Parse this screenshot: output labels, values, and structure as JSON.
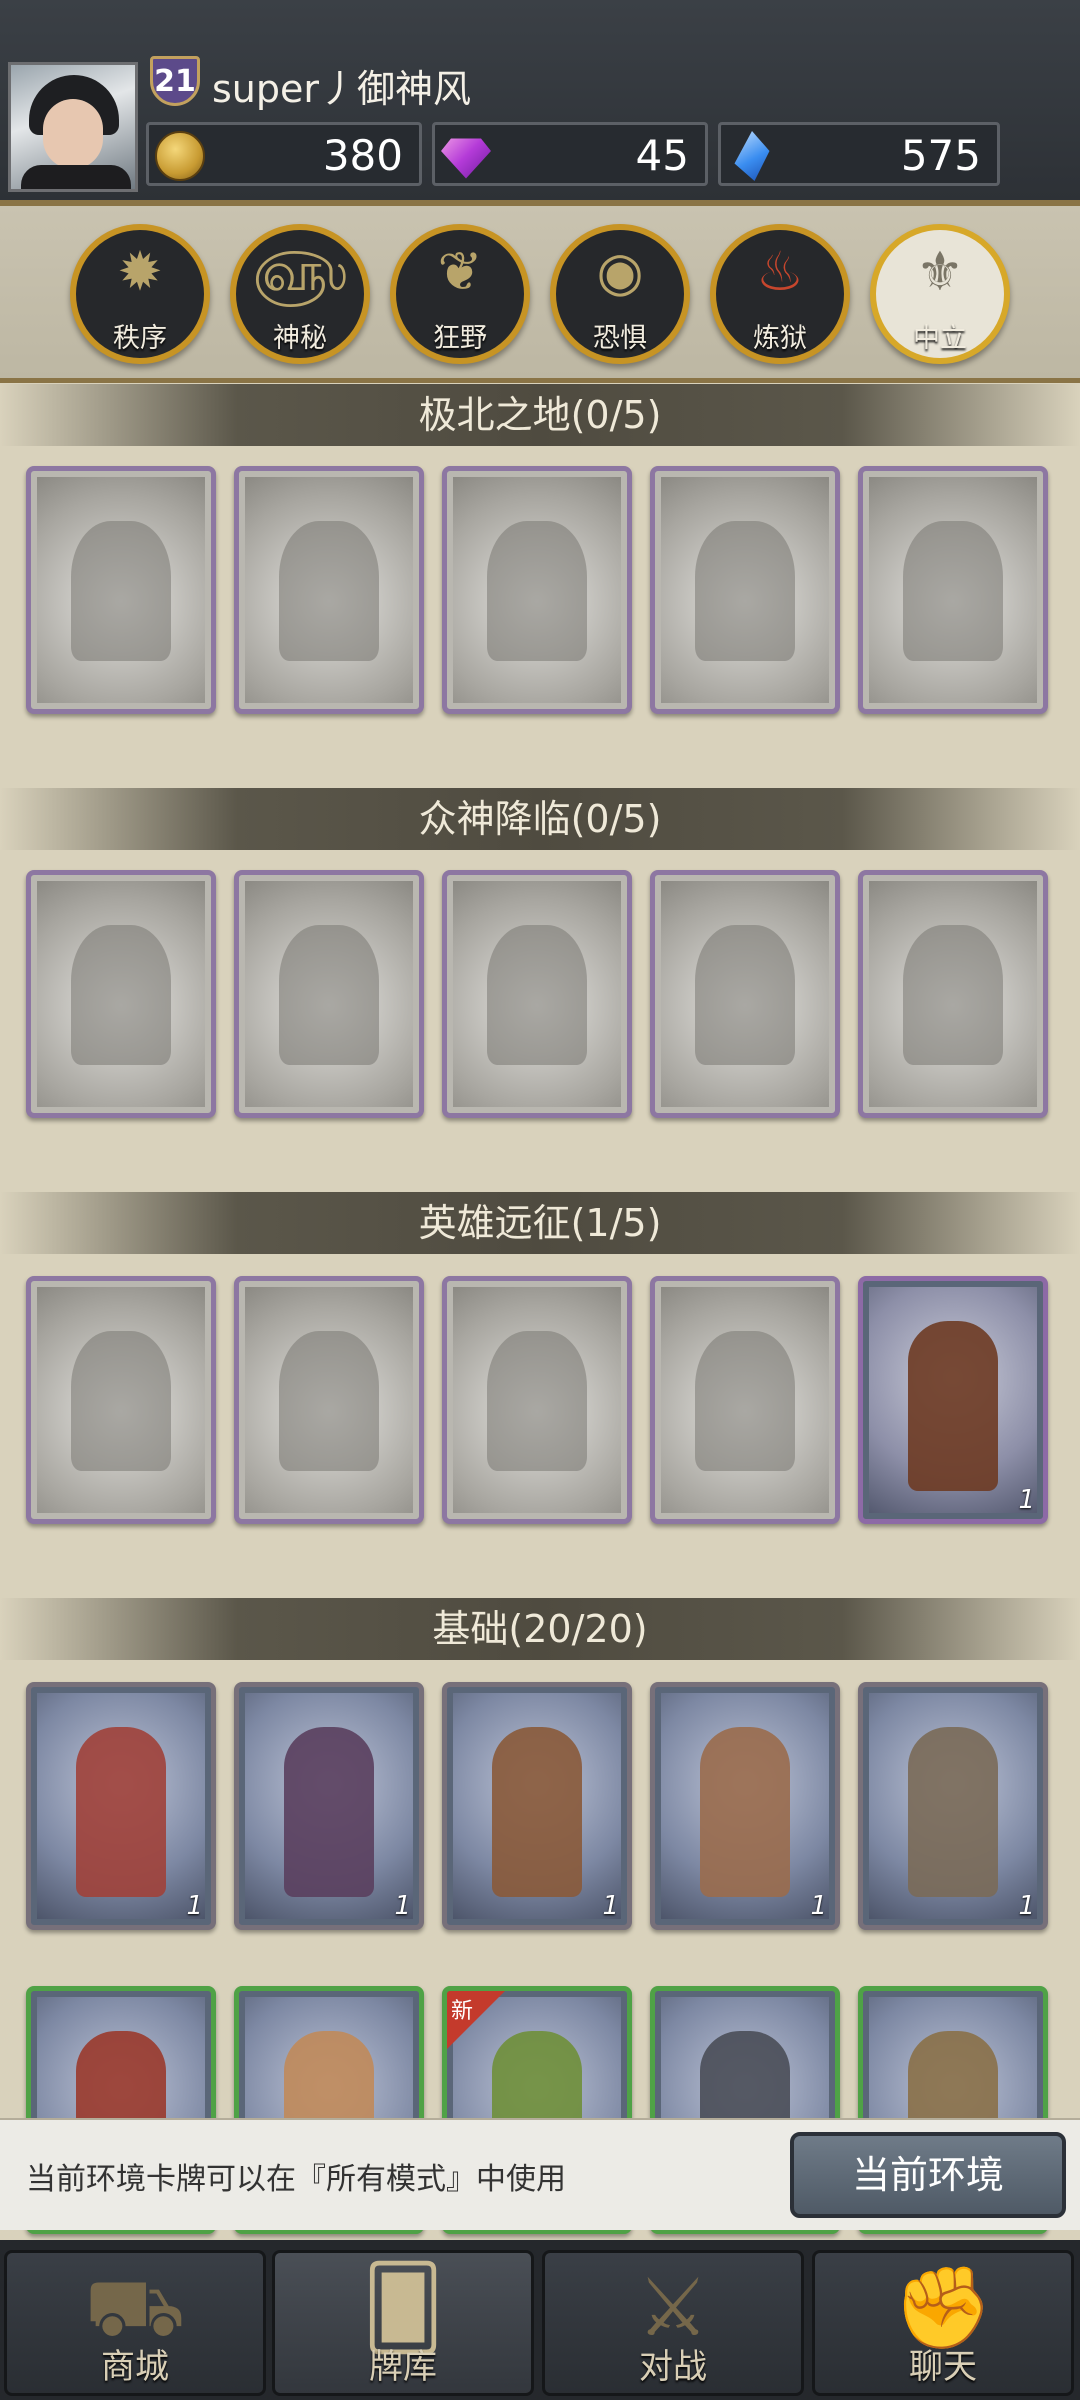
{
  "header": {
    "level": "21",
    "username": "super丿御神风",
    "gold": "380",
    "gems": "45",
    "crystals": "575"
  },
  "factions": [
    {
      "label": "秩序",
      "icon": "sun-icon"
    },
    {
      "label": "神秘",
      "icon": "swirl-icon"
    },
    {
      "label": "狂野",
      "icon": "leaf-icon"
    },
    {
      "label": "恐惧",
      "icon": "eye-icon"
    },
    {
      "label": "炼狱",
      "icon": "flame-icon"
    },
    {
      "label": "中立",
      "icon": "crest-icon"
    }
  ],
  "sections": [
    {
      "title": "极北之地(0/5)"
    },
    {
      "title": "众神降临(0/5)"
    },
    {
      "title": "英雄远征(1/5)"
    },
    {
      "title": "基础(20/20)"
    }
  ],
  "cards": {
    "count_label": "1",
    "new_label": "新"
  },
  "info": {
    "text": "当前环境卡牌可以在『所有模式』中使用",
    "button": "当前环境"
  },
  "nav": [
    {
      "label": "商城",
      "icon": "shop-icon"
    },
    {
      "label": "牌库",
      "icon": "deck-icon"
    },
    {
      "label": "对战",
      "icon": "swords-icon"
    },
    {
      "label": "聊天",
      "icon": "chat-icon"
    }
  ]
}
